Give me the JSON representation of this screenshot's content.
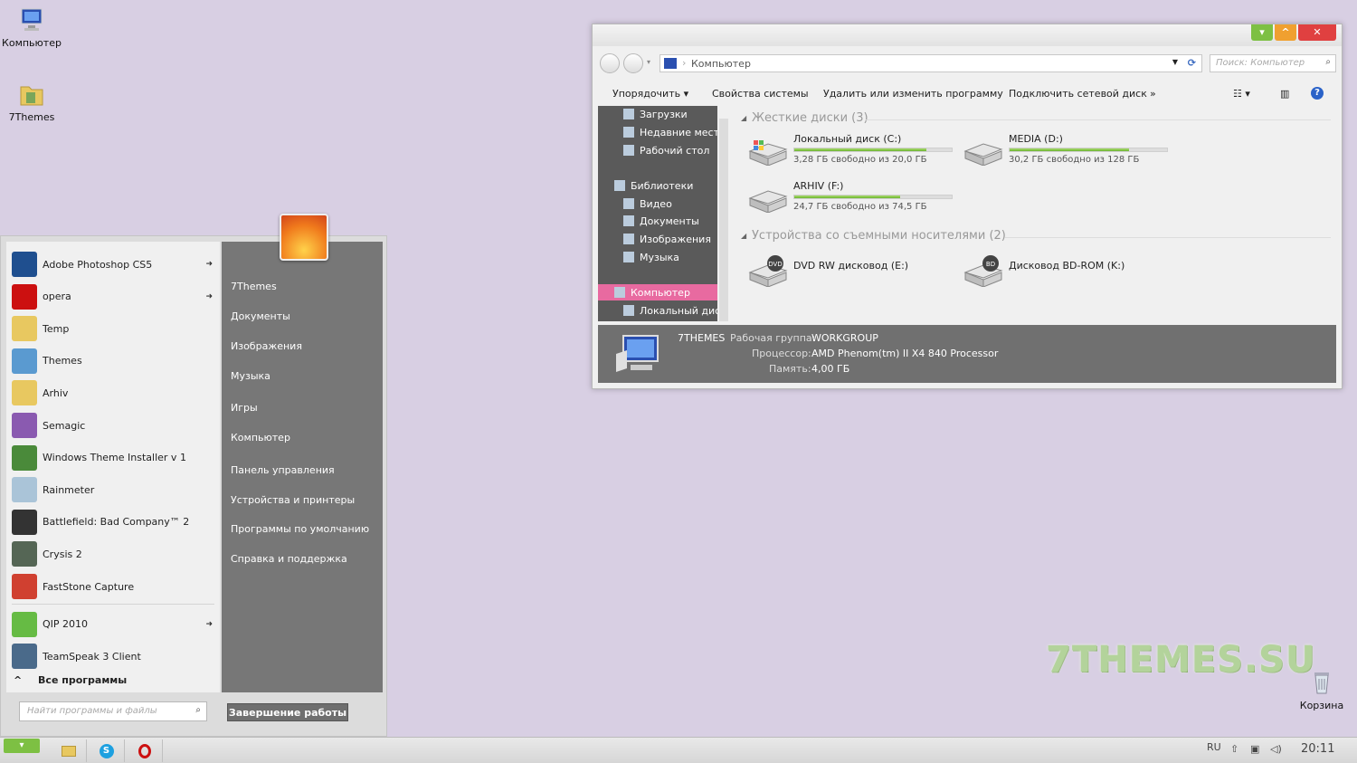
{
  "desktop": {
    "icons": [
      {
        "label": "Компьютер",
        "icon": "computer-icon"
      },
      {
        "label": "7Themes",
        "icon": "folder-icon"
      },
      {
        "label": "Корзина",
        "icon": "recycle-bin-icon"
      }
    ],
    "watermark": "7THEMES.SU"
  },
  "explorer": {
    "address": "Компьютер",
    "search_placeholder": "Поиск: Компьютер",
    "commands": [
      "Упорядочить",
      "Свойства системы",
      "Удалить или изменить программу",
      "Подключить сетевой диск"
    ],
    "more": "»",
    "nav": {
      "favorites": [
        "Загрузки",
        "Недавние места",
        "Рабочий стол"
      ],
      "libraries_label": "Библиотеки",
      "libraries": [
        "Видео",
        "Документы",
        "Изображения",
        "Музыка"
      ],
      "computer": "Компьютер",
      "local_disk": "Локальный диск"
    },
    "groups": {
      "hdd": "Жесткие диски (3)",
      "removable": "Устройства со съемными носителями (2)"
    },
    "drives": [
      {
        "name": "Локальный диск (C:)",
        "free": "3,28 ГБ свободно из 20,0 ГБ",
        "used_fraction": 0.84
      },
      {
        "name": "MEDIA (D:)",
        "free": "30,2 ГБ свободно из 128 ГБ",
        "used_fraction": 0.76
      },
      {
        "name": "ARHIV (F:)",
        "free": "24,7 ГБ свободно из 74,5 ГБ",
        "used_fraction": 0.67
      }
    ],
    "removable": [
      {
        "name": "DVD RW дисковод (E:)",
        "badge": "DVD"
      },
      {
        "name": "Дисковод BD-ROM (K:)",
        "badge": "BD"
      }
    ],
    "details": {
      "name": "7THEMES",
      "workgroup_label": "Рабочая группа:",
      "workgroup": "WORKGROUP",
      "cpu_label": "Процессор:",
      "cpu": "AMD Phenom(tm) II X4 840 Processor",
      "mem_label": "Память:",
      "mem": "4,00 ГБ"
    }
  },
  "start_menu": {
    "programs": [
      {
        "label": "Adobe Photoshop CS5",
        "arrow": true,
        "color": "#1f4f8f"
      },
      {
        "label": "opera",
        "arrow": true,
        "color": "#cc1010"
      },
      {
        "label": "Temp",
        "arrow": false,
        "color": "#e8c860"
      },
      {
        "label": "Themes",
        "arrow": false,
        "color": "#5a9ad0"
      },
      {
        "label": "Arhiv",
        "arrow": false,
        "color": "#e8c860"
      },
      {
        "label": "Semagic",
        "arrow": false,
        "color": "#8a5ab0"
      },
      {
        "label": "Windows Theme Installer v 1",
        "arrow": false,
        "color": "#4a8a3a"
      },
      {
        "label": "Rainmeter",
        "arrow": false,
        "color": "#aac4d8"
      },
      {
        "label": "Battlefield: Bad Company™ 2",
        "arrow": false,
        "color": "#333333"
      },
      {
        "label": "Crysis 2",
        "arrow": false,
        "color": "#556655"
      },
      {
        "label": "FastStone Capture",
        "arrow": false,
        "color": "#d04030"
      },
      {
        "label": "QIP 2010",
        "arrow": true,
        "color": "#66bb44"
      },
      {
        "label": "TeamSpeak 3 Client",
        "arrow": false,
        "color": "#4a6a8a"
      }
    ],
    "all_programs": "Все программы",
    "places": [
      "7Themes",
      "Документы",
      "Изображения",
      "Музыка",
      "Игры",
      "Компьютер",
      "Панель управления",
      "Устройства и принтеры",
      "Программы по умолчанию",
      "Справка и поддержка"
    ],
    "search_placeholder": "Найти программы и файлы",
    "shutdown": "Завершение работы"
  },
  "taskbar": {
    "lang": "RU",
    "clock": "20:11"
  }
}
